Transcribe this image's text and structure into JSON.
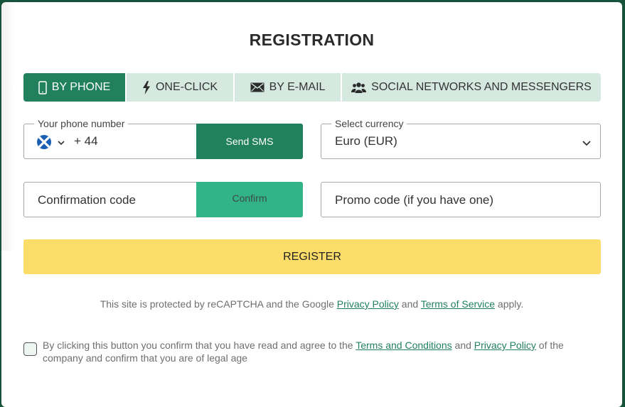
{
  "title": "REGISTRATION",
  "tabs": [
    {
      "label": "BY PHONE",
      "icon": "mobile-phone-icon",
      "active": true
    },
    {
      "label": "ONE-CLICK",
      "icon": "lightning-bolt-icon",
      "active": false
    },
    {
      "label": "BY E-MAIL",
      "icon": "envelope-icon",
      "active": false
    },
    {
      "label": "SOCIAL NETWORKS AND MESSENGERS",
      "icon": "users-group-icon",
      "active": false
    }
  ],
  "phone": {
    "legend": "Your phone number",
    "country_flag": "scotland-flag-icon",
    "dial_code": "+ 44",
    "send_sms_label": "Send SMS"
  },
  "currency": {
    "legend": "Select currency",
    "selected": "Euro (EUR)"
  },
  "confirmation": {
    "placeholder": "Confirmation code",
    "confirm_label": "Confirm"
  },
  "promo": {
    "placeholder": "Promo code (if you have one)"
  },
  "register_label": "REGISTER",
  "recaptcha": {
    "prefix": "This site is protected by reCAPTCHA and the Google ",
    "privacy_link": "Privacy Policy",
    "middle": " and ",
    "terms_link": "Terms of Service",
    "suffix": " apply."
  },
  "agreement": {
    "checked": false,
    "prefix": "By clicking this button you confirm that you have read and agree to the ",
    "terms_link": "Terms and Conditions",
    "middle": " and ",
    "privacy_link": "Privacy Policy",
    "suffix": " of the company and confirm that you are of legal age"
  },
  "colors": {
    "brand_green": "#21805d",
    "confirm_green": "#33b388",
    "tab_inactive_bg": "#d6e9e1",
    "register_yellow": "#fcdd6a",
    "backdrop": "#17533b"
  }
}
